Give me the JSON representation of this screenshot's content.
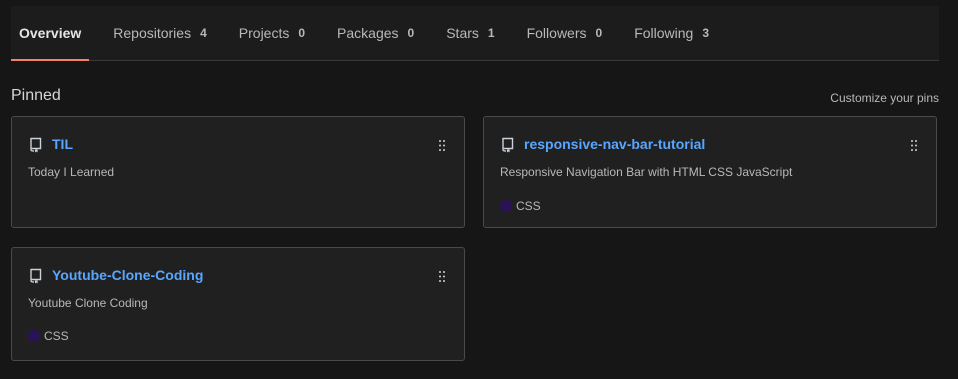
{
  "tabs": [
    {
      "label": "Overview",
      "count": "",
      "active": true
    },
    {
      "label": "Repositories",
      "count": "4"
    },
    {
      "label": "Projects",
      "count": "0"
    },
    {
      "label": "Packages",
      "count": "0"
    },
    {
      "label": "Stars",
      "count": "1"
    },
    {
      "label": "Followers",
      "count": "0"
    },
    {
      "label": "Following",
      "count": "3"
    }
  ],
  "pinned": {
    "title": "Pinned",
    "customize_label": "Customize your pins",
    "repos": [
      {
        "name": "TIL",
        "description": "Today I Learned",
        "language": "",
        "language_color": "",
        "icon": "repo-icon"
      },
      {
        "name": "responsive-nav-bar-tutorial",
        "description": "Responsive Navigation Bar with HTML CSS JavaScript",
        "language": "CSS",
        "language_color": "#2b1257",
        "icon": "repo-icon"
      },
      {
        "name": "Youtube-Clone-Coding",
        "description": "Youtube Clone Coding",
        "language": "CSS",
        "language_color": "#2b1257",
        "icon": "repo-icon"
      }
    ]
  },
  "colors": {
    "accent_underline": "#f78166",
    "link": "#58a6ff",
    "background": "#161616"
  }
}
